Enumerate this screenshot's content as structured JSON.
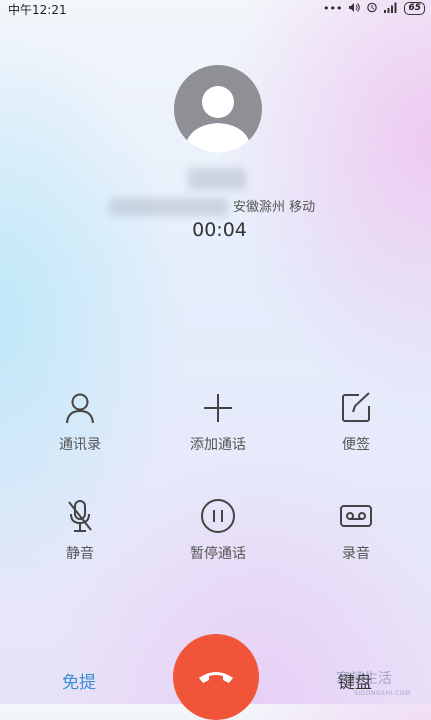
{
  "status_bar": {
    "time": "中午12:21",
    "dots": "•••",
    "battery": "65"
  },
  "caller": {
    "location": "安徽滁州 移动",
    "duration": "00:04"
  },
  "actions": {
    "contacts": "通讯录",
    "add_call": "添加通话",
    "notes": "便签",
    "mute": "静音",
    "hold": "暂停通话",
    "record": "录音"
  },
  "bottom": {
    "speaker": "免提",
    "keypad": "键盘"
  },
  "watermark": {
    "text": "塞顿生活",
    "sub": "SIDONGSHI.COM"
  },
  "colors": {
    "accent": "#3a8fd6",
    "end_call": "#f0553a"
  }
}
